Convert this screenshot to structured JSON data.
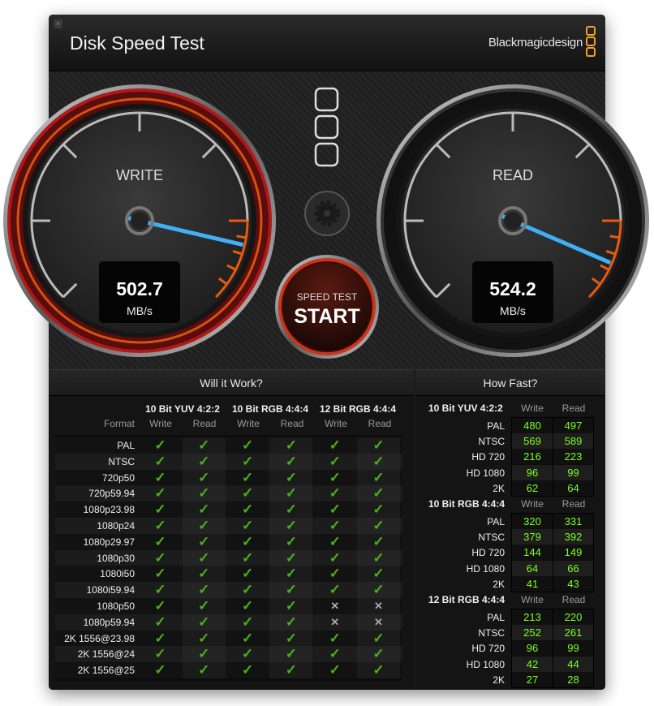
{
  "window": {
    "title": "Disk Speed Test",
    "brand": "Blackmagicdesign",
    "close_icon": "close-icon"
  },
  "gauges": {
    "write": {
      "label": "WRITE",
      "value": "502.7",
      "unit": "MB/s"
    },
    "read": {
      "label": "READ",
      "value": "524.2",
      "unit": "MB/s"
    }
  },
  "start_button": {
    "top": "SPEED TEST",
    "label": "START"
  },
  "settings_icon": "gear-icon",
  "will_it_work": {
    "title": "Will it Work?",
    "format_label": "Format",
    "groups": [
      "10 Bit YUV 4:2:2",
      "10 Bit RGB 4:4:4",
      "12 Bit RGB 4:4:4"
    ],
    "sub": [
      "Write",
      "Read"
    ],
    "rows": [
      {
        "format": "PAL",
        "ok": [
          1,
          1,
          1,
          1,
          1,
          1
        ]
      },
      {
        "format": "NTSC",
        "ok": [
          1,
          1,
          1,
          1,
          1,
          1
        ]
      },
      {
        "format": "720p50",
        "ok": [
          1,
          1,
          1,
          1,
          1,
          1
        ]
      },
      {
        "format": "720p59.94",
        "ok": [
          1,
          1,
          1,
          1,
          1,
          1
        ]
      },
      {
        "format": "1080p23.98",
        "ok": [
          1,
          1,
          1,
          1,
          1,
          1
        ]
      },
      {
        "format": "1080p24",
        "ok": [
          1,
          1,
          1,
          1,
          1,
          1
        ]
      },
      {
        "format": "1080p29.97",
        "ok": [
          1,
          1,
          1,
          1,
          1,
          1
        ]
      },
      {
        "format": "1080p30",
        "ok": [
          1,
          1,
          1,
          1,
          1,
          1
        ]
      },
      {
        "format": "1080i50",
        "ok": [
          1,
          1,
          1,
          1,
          1,
          1
        ]
      },
      {
        "format": "1080i59.94",
        "ok": [
          1,
          1,
          1,
          1,
          1,
          1
        ]
      },
      {
        "format": "1080p50",
        "ok": [
          1,
          1,
          1,
          1,
          0,
          0
        ]
      },
      {
        "format": "1080p59.94",
        "ok": [
          1,
          1,
          1,
          1,
          0,
          0
        ]
      },
      {
        "format": "2K 1556@23.98",
        "ok": [
          1,
          1,
          1,
          1,
          1,
          1
        ]
      },
      {
        "format": "2K 1556@24",
        "ok": [
          1,
          1,
          1,
          1,
          1,
          1
        ]
      },
      {
        "format": "2K 1556@25",
        "ok": [
          1,
          1,
          1,
          1,
          1,
          1
        ]
      }
    ]
  },
  "how_fast": {
    "title": "How Fast?",
    "write_label": "Write",
    "read_label": "Read",
    "groups": [
      {
        "name": "10 Bit YUV 4:2:2",
        "rows": [
          [
            "PAL",
            "480",
            "497"
          ],
          [
            "NTSC",
            "569",
            "589"
          ],
          [
            "HD 720",
            "216",
            "223"
          ],
          [
            "HD 1080",
            "96",
            "99"
          ],
          [
            "2K",
            "62",
            "64"
          ]
        ]
      },
      {
        "name": "10 Bit RGB 4:4:4",
        "rows": [
          [
            "PAL",
            "320",
            "331"
          ],
          [
            "NTSC",
            "379",
            "392"
          ],
          [
            "HD 720",
            "144",
            "149"
          ],
          [
            "HD 1080",
            "64",
            "66"
          ],
          [
            "2K",
            "41",
            "43"
          ]
        ]
      },
      {
        "name": "12 Bit RGB 4:4:4",
        "rows": [
          [
            "PAL",
            "213",
            "220"
          ],
          [
            "NTSC",
            "252",
            "261"
          ],
          [
            "HD 720",
            "96",
            "99"
          ],
          [
            "HD 1080",
            "42",
            "44"
          ],
          [
            "2K",
            "27",
            "28"
          ]
        ]
      }
    ]
  },
  "colors": {
    "accent_orange": "#f3a21f",
    "needle": "#3fb0f5",
    "check": "#4fae19",
    "value_green": "#7dff1e",
    "write_ring": "#8c1414"
  }
}
